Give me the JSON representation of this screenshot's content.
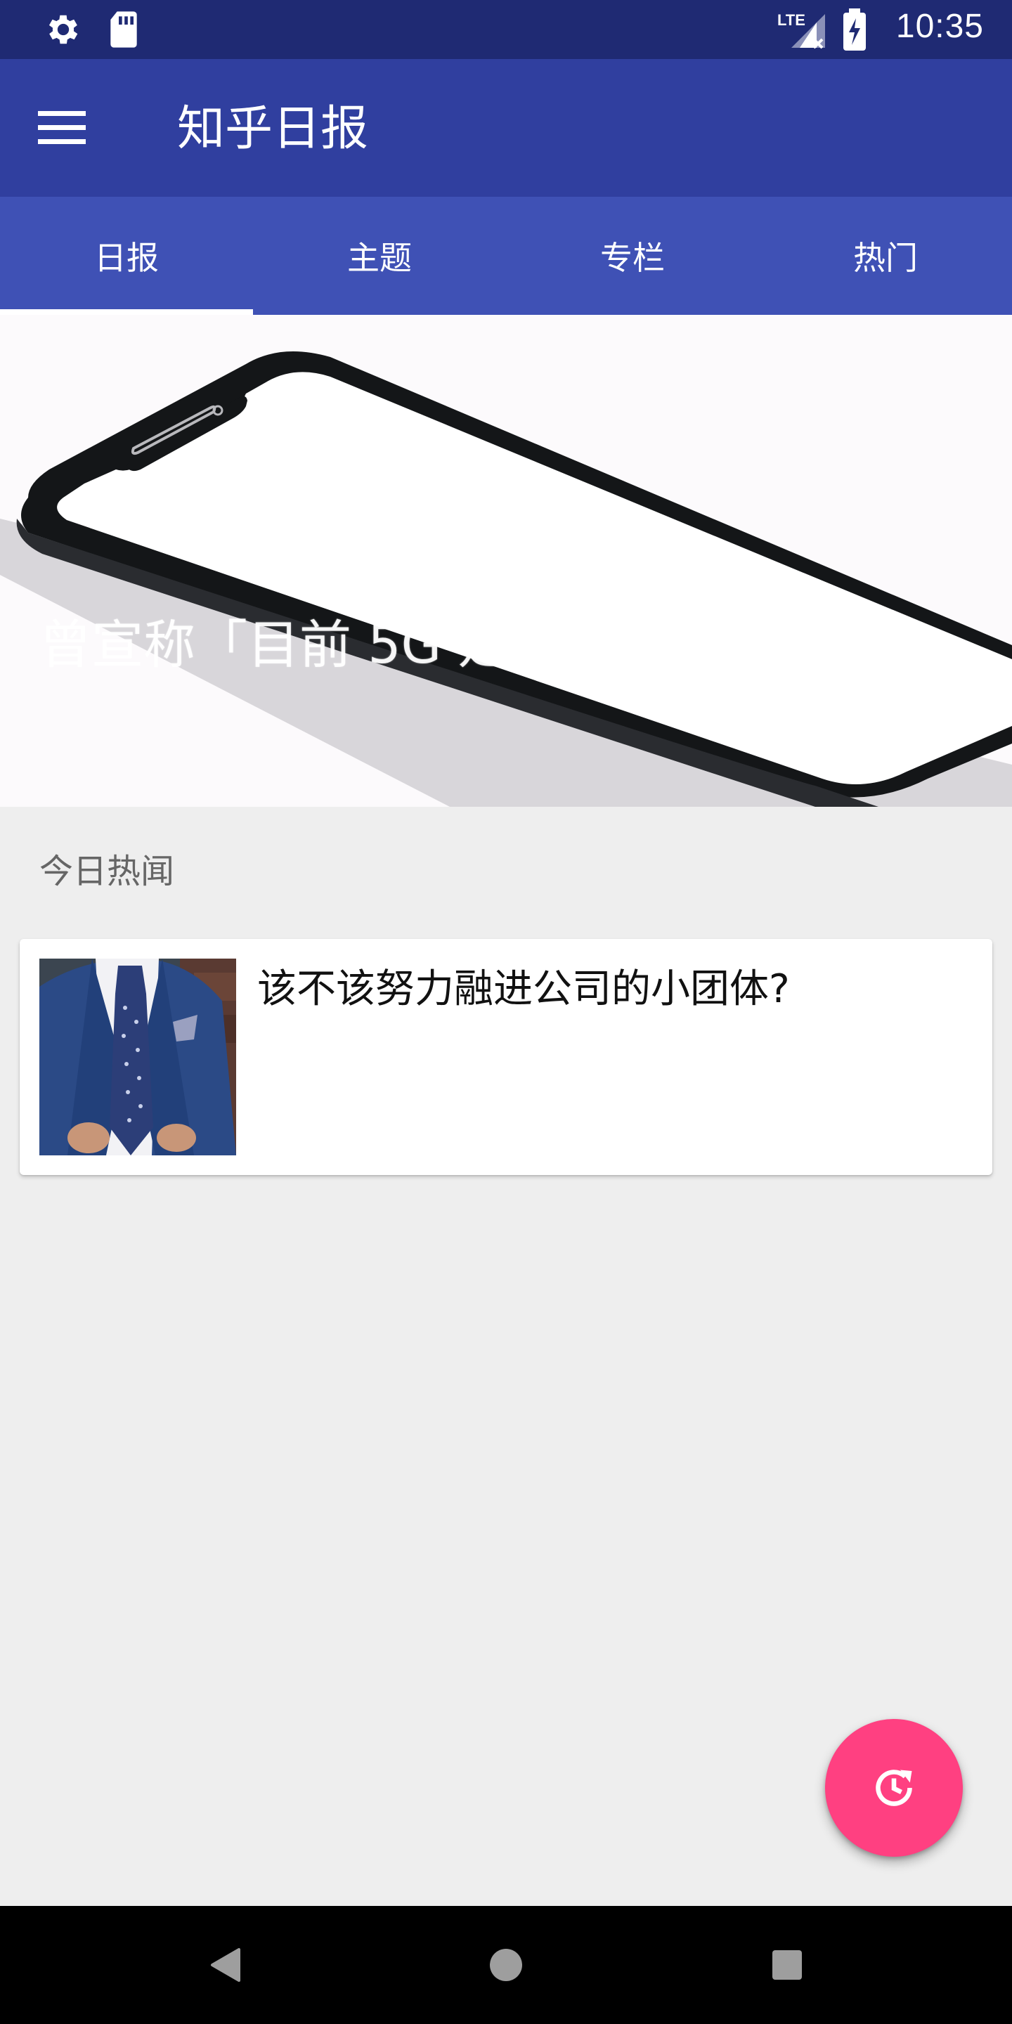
{
  "status_bar": {
    "time": "10:35",
    "network_label": "LTE",
    "icons": [
      "gear-icon",
      "sd-card-icon",
      "signal-icon",
      "battery-charging-icon"
    ]
  },
  "app_bar": {
    "title": "知乎日报",
    "menu_icon": "hamburger-menu-icon"
  },
  "tabs": [
    {
      "label": "日报",
      "active": true
    },
    {
      "label": "主题",
      "active": false
    },
    {
      "label": "专栏",
      "active": false
    },
    {
      "label": "热门",
      "active": false
    }
  ],
  "banner": {
    "title": "曾宣称「目前 5G 是个坑」，怎么理解？"
  },
  "section": {
    "header": "今日热闻"
  },
  "stories": [
    {
      "title": "该不该努力融进公司的小团体?"
    }
  ],
  "fab": {
    "icon": "refresh-clock-icon"
  },
  "colors": {
    "status_bar": "#1f2a73",
    "primary_dark": "#303f9f",
    "primary": "#3f51b5",
    "accent": "#ff4081",
    "background": "#eeeeee"
  },
  "nav_bar": {
    "buttons": [
      "back-icon",
      "home-icon",
      "recents-icon"
    ]
  }
}
